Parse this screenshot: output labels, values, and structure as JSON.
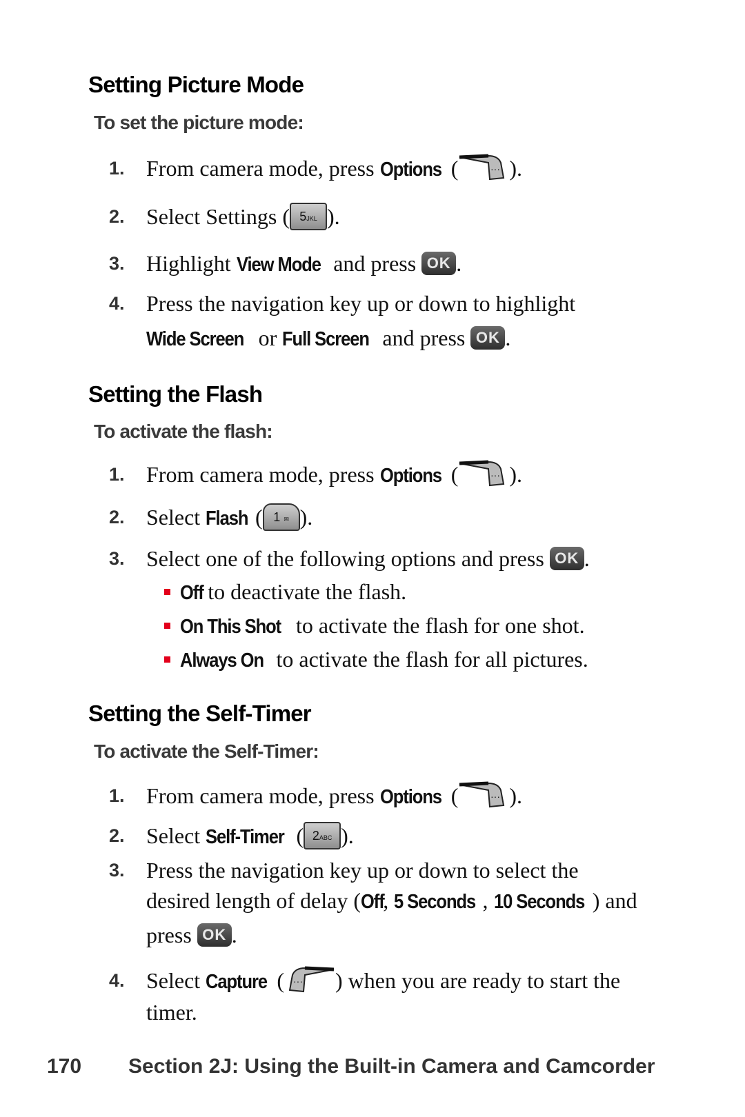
{
  "sections": [
    {
      "title": "Setting Picture Mode",
      "subtitle": "To set the picture mode:",
      "steps": [
        {
          "num": "1.",
          "pre": "From camera mode, press ",
          "bold": "Options",
          "post_open": " (",
          "post": ")."
        },
        {
          "num": "2.",
          "pre": "Select Settings (",
          "post": ")."
        },
        {
          "num": "3.",
          "pre": "Highlight ",
          "bold": "View Mode",
          "mid": " and press ",
          "post": "."
        },
        {
          "num": "4.",
          "line1": "Press the navigation key up or down to highlight",
          "bold1": "Wide Screen",
          "or": " or ",
          "bold2": "Full Screen",
          "mid": " and press ",
          "post": "."
        }
      ]
    },
    {
      "title": "Setting the Flash",
      "subtitle": "To activate the flash:",
      "steps": [
        {
          "num": "1.",
          "pre": "From camera mode, press ",
          "bold": "Options",
          "post_open": " (",
          "post": ")."
        },
        {
          "num": "2.",
          "pre": "Select ",
          "bold": "Flash",
          "post_open": " (",
          "post": ")."
        },
        {
          "num": "3.",
          "pre": "Select one of the following options and press ",
          "post": "."
        }
      ],
      "options": [
        {
          "bold": "Off",
          "text": " to deactivate the flash."
        },
        {
          "bold": "On This Shot",
          "text": " to activate the flash for one shot."
        },
        {
          "bold": "Always On",
          "text": " to activate the flash for all pictures."
        }
      ]
    },
    {
      "title": "Setting the Self-Timer",
      "subtitle": "To activate the Self-Timer:",
      "steps": [
        {
          "num": "1.",
          "pre": "From camera mode, press ",
          "bold": "Options",
          "post_open": " (",
          "post": ")."
        },
        {
          "num": "2.",
          "pre": "Select ",
          "bold": "Self-Timer",
          "post_open": " (",
          "post": ")."
        },
        {
          "num": "3.",
          "line1": "Press the navigation key up or down to select the",
          "line2_pre": "desired length of delay (",
          "opt1": "Off",
          "sep": ", ",
          "opt2": "5 Seconds",
          "opt3": "10 Seconds",
          "line2_post": ") and",
          "line3_pre": "press ",
          "post": "."
        },
        {
          "num": "4.",
          "pre": "Select ",
          "bold": "Capture",
          "post_open": " (",
          "post": ") when you are ready to start the",
          "line2": "timer."
        }
      ]
    }
  ],
  "keys": {
    "ok": "OK",
    "options_glyph": "···",
    "key5": "5",
    "key5_sub": "JKL",
    "key1": "1",
    "key1_sub": "✉",
    "key2": "2",
    "key2_sub": "ABC"
  },
  "footer": {
    "page_number": "170",
    "section": "Section 2J: Using the Built-in Camera and Camcorder"
  },
  "colors": {
    "bullet": "#e3001b"
  }
}
